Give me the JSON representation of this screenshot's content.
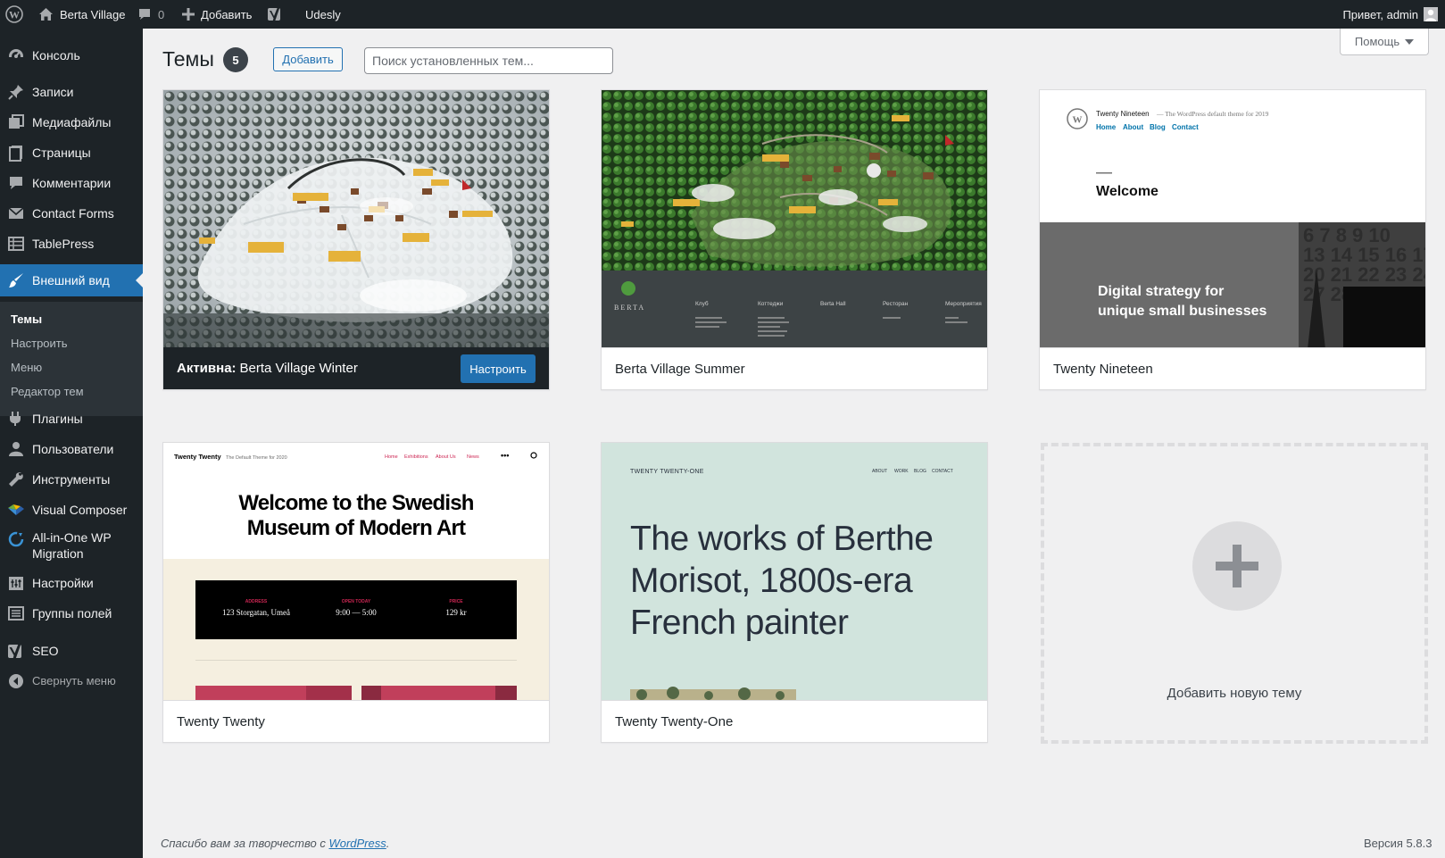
{
  "adminbar": {
    "site_name": "Berta Village",
    "comments_count": "0",
    "new_label": "Добавить",
    "udesly_label": "Udesly",
    "greeting": "Привет, admin"
  },
  "sidebar": {
    "items": [
      {
        "label": "Консоль",
        "icon": "dashboard-icon"
      },
      {
        "label": "Записи",
        "icon": "pin-icon"
      },
      {
        "label": "Медиафайлы",
        "icon": "media-icon"
      },
      {
        "label": "Страницы",
        "icon": "page-icon"
      },
      {
        "label": "Комментарии",
        "icon": "comment-icon"
      },
      {
        "label": "Contact Forms",
        "icon": "mail-icon"
      },
      {
        "label": "TablePress",
        "icon": "table-icon"
      },
      {
        "label": "Внешний вид",
        "icon": "brush-icon"
      },
      {
        "label": "Плагины",
        "icon": "plugin-icon"
      },
      {
        "label": "Пользователи",
        "icon": "users-icon"
      },
      {
        "label": "Инструменты",
        "icon": "wrench-icon"
      },
      {
        "label": "Visual Composer",
        "icon": "vc-icon"
      },
      {
        "label": "All-in-One WP Migration",
        "icon": "migration-icon"
      },
      {
        "label": "Настройки",
        "icon": "settings-icon"
      },
      {
        "label": "Группы полей",
        "icon": "fields-icon"
      },
      {
        "label": "SEO",
        "icon": "yoast-icon"
      }
    ],
    "submenu": [
      "Темы",
      "Настроить",
      "Меню",
      "Редактор тем"
    ],
    "collapse_label": "Свернуть меню"
  },
  "page": {
    "title": "Темы",
    "count": "5",
    "add_button": "Добавить",
    "search_placeholder": "Поиск установленных тем...",
    "help_button": "Помощь"
  },
  "themes": [
    {
      "name": "Berta Village Winter",
      "active": true,
      "active_prefix": "Активна:",
      "customize": "Настроить"
    },
    {
      "name": "Berta Village Summer",
      "active": false
    },
    {
      "name": "Twenty Nineteen",
      "active": false
    },
    {
      "name": "Twenty Twenty",
      "active": false
    },
    {
      "name": "Twenty Twenty-One",
      "active": false
    }
  ],
  "add_new_theme": "Добавить новую тему",
  "previews": {
    "summer_brand": "BERTA",
    "summer_cols": [
      "Клуб",
      "Коттеджи",
      "Berta Hall",
      "Ресторан",
      "Мероприятия"
    ],
    "nineteen_site": "Twenty Nineteen",
    "nineteen_tagline": "— The WordPress default theme for 2019",
    "nineteen_nav": [
      "Home",
      "About",
      "Blog",
      "Contact"
    ],
    "nineteen_welcome": "Welcome",
    "nineteen_hero": "Digital strategy for unique small businesses",
    "twenty_site": "Twenty Twenty",
    "twenty_tagline": "The Default Theme for 2020",
    "twenty_nav": [
      "Home",
      "Exhibitions",
      "About Us",
      "News"
    ],
    "twenty_headline": "Welcome to the Swedish Museum of Modern Art",
    "twenty_info": [
      {
        "label": "ADDRESS",
        "value": "123 Storgatan, Umeå"
      },
      {
        "label": "OPEN TODAY",
        "value": "9:00 — 5:00"
      },
      {
        "label": "PRICE",
        "value": "129 kr"
      }
    ],
    "tto_site": "TWENTY TWENTY-ONE",
    "tto_nav": [
      "ABOUT",
      "WORK",
      "BLOG",
      "CONTACT"
    ],
    "tto_headline": "The works of Berthe Morisot, 1800s-era French painter"
  },
  "footer": {
    "thanks_prefix": "Спасибо вам за творчество с ",
    "wp_link": "WordPress",
    "thanks_suffix": ".",
    "version": "Версия 5.8.3"
  }
}
